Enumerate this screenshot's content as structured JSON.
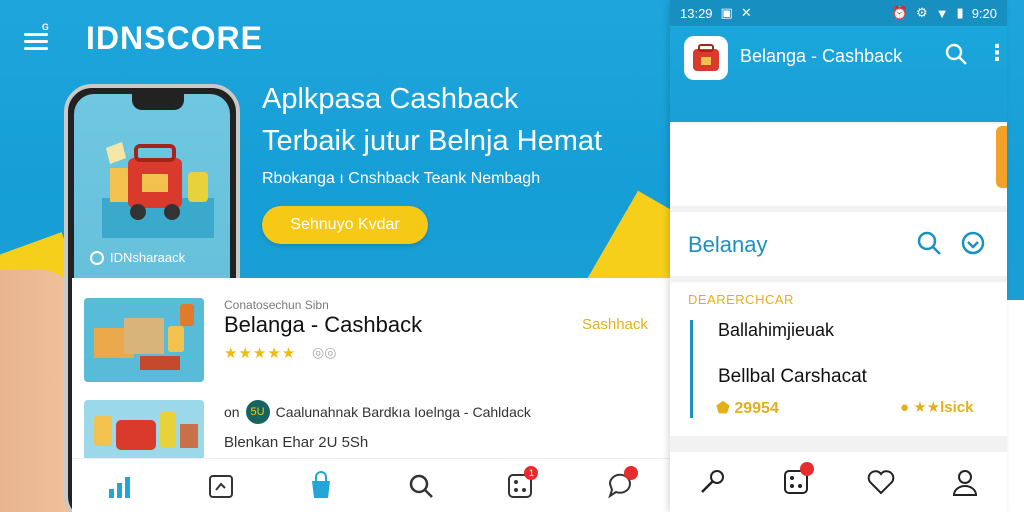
{
  "brand": {
    "name": "IDNSCORE"
  },
  "hero": {
    "title_line1": "Aplkpasa Cashback",
    "title_line2": "Terbaik jutur Belnja Hemat",
    "subtitle": "Rbokanga ı Cnshback Teank Nembagh",
    "cta_label": "Sehnuyo Kvdar"
  },
  "phone": {
    "caption": "IDNsharaack"
  },
  "feed": {
    "item1": {
      "meta": "Conatosechun Sibn",
      "title": "Belanga - Cashback",
      "tag": "Sashhack",
      "stars": "★★★★★"
    },
    "item2": {
      "prefix": "on",
      "badge": "5U",
      "line1": "Caalunahnak  Bardkıa Ioelnga - Cahldack",
      "line2": "Blenkan Ehar 2U 5Sh"
    }
  },
  "statusbar": {
    "left_time": "13:29",
    "right_time": "9:20"
  },
  "app": {
    "title": "Belanga - Cashback",
    "section_label": "Belanay",
    "list_heading": "DEARERCHCAR",
    "row1": "Ballahimjieuak",
    "row2": "Bellbal Carshacat",
    "points": "29954",
    "rating": "★★lsick"
  },
  "colors": {
    "primary": "#1ea6dc",
    "accent": "#f6c917",
    "app_bar": "#178fc1",
    "tag_gold": "#e3b01a"
  },
  "icons": {
    "feed_tabs": [
      "chart-icon",
      "calendar-icon",
      "shopping-bag-icon",
      "search-icon",
      "dice-icon",
      "chat-icon"
    ],
    "app_tabs": [
      "key-icon",
      "dice-icon",
      "heart-icon",
      "user-icon"
    ]
  }
}
